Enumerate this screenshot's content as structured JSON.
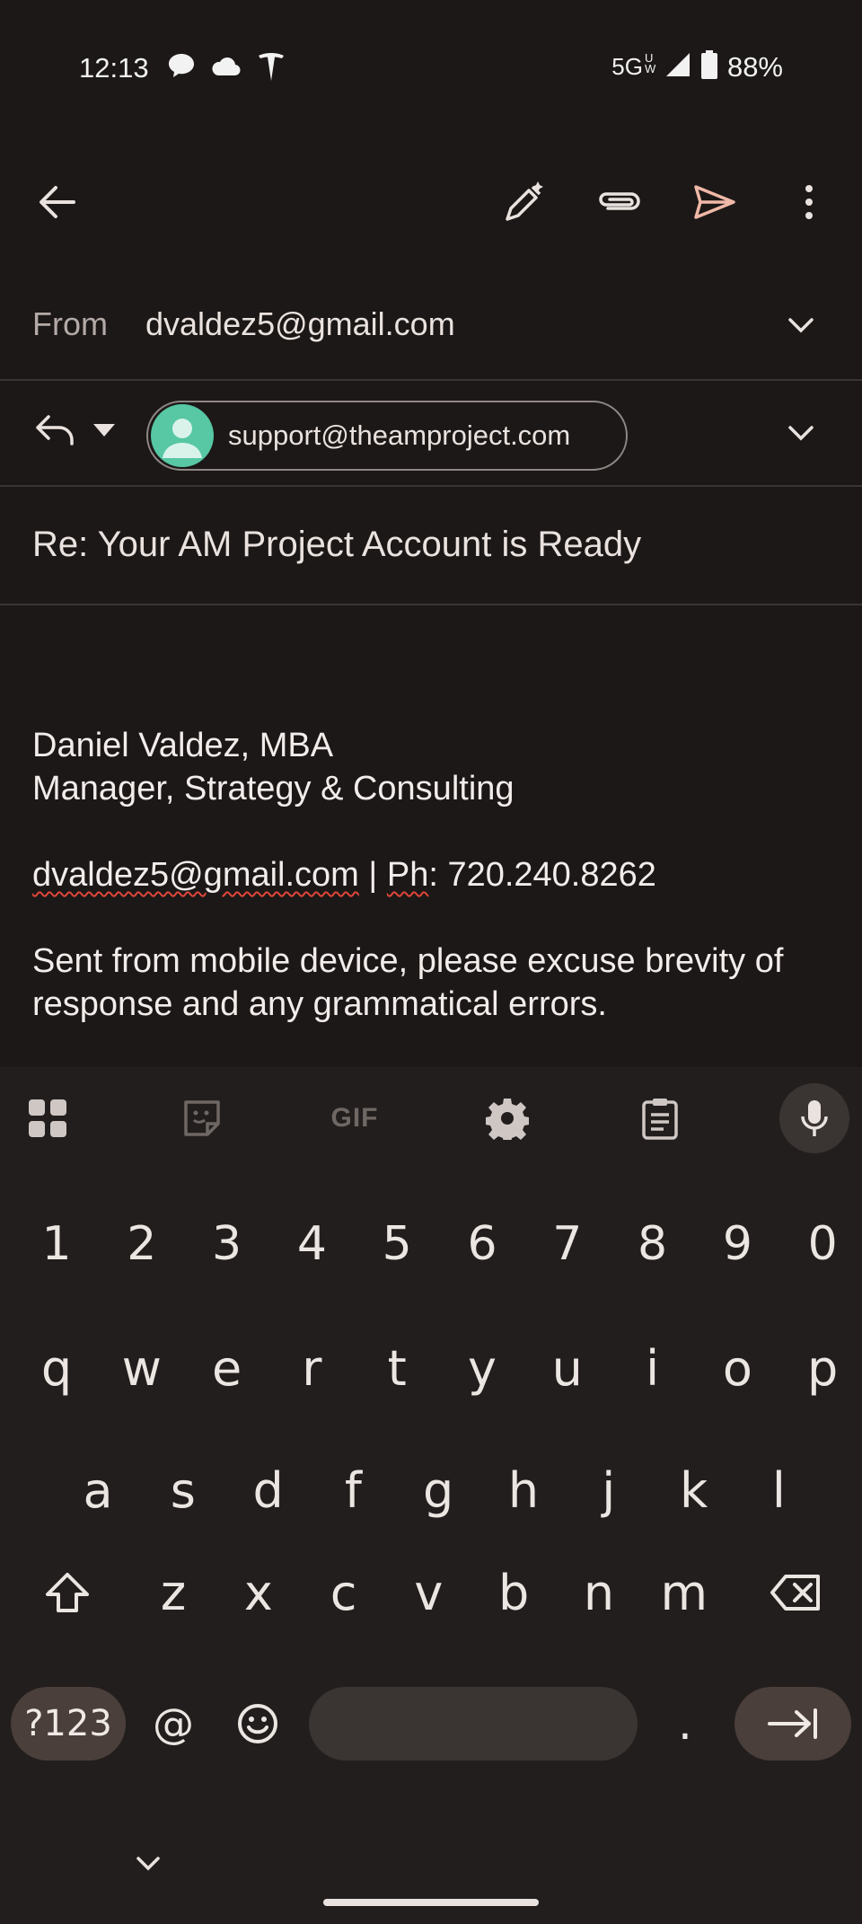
{
  "status_bar": {
    "time": "12:13",
    "network": "5G",
    "network_sup": "UW",
    "battery": "88%",
    "icons": [
      "chat-bubble-icon",
      "cloud-icon",
      "tesla-icon",
      "signal-icon",
      "battery-icon"
    ]
  },
  "toolbar": {
    "back": "back-arrow-icon",
    "compose_ai": "pencil-sparkle-icon",
    "attach": "paperclip-icon",
    "send": "send-icon",
    "more": "more-vert-icon"
  },
  "header": {
    "from_label": "From",
    "from_value": "dvaldez5@gmail.com",
    "to_chip": "support@theamproject.com",
    "subject": "Re: Your AM Project Account is Ready"
  },
  "body": {
    "name": "Daniel Valdez, MBA",
    "title": "Manager, Strategy & Consulting",
    "contact_email": "dvaldez5@gmail.com",
    "contact_sep": " | ",
    "contact_ph_label": "Ph",
    "contact_phone": ": 720.240.8262",
    "disclaimer_line1": "Sent from mobile device, please excuse brevity of",
    "disclaimer_line2": "response and any grammatical errors."
  },
  "keyboard": {
    "toolbar": {
      "gif": "GIF"
    },
    "numbers": [
      "1",
      "2",
      "3",
      "4",
      "5",
      "6",
      "7",
      "8",
      "9",
      "0"
    ],
    "row1": [
      "q",
      "w",
      "e",
      "r",
      "t",
      "y",
      "u",
      "i",
      "o",
      "p"
    ],
    "row2": [
      "a",
      "s",
      "d",
      "f",
      "g",
      "h",
      "j",
      "k",
      "l"
    ],
    "row3": [
      "z",
      "x",
      "c",
      "v",
      "b",
      "n",
      "m"
    ],
    "symbols_key": "?123",
    "at_key": "@",
    "period_key": "."
  },
  "colors": {
    "background": "#1c1817",
    "keyboard_bg": "#221e1d",
    "send_accent": "#f0b8a8",
    "avatar_green": "#57c7a4",
    "pill_key": "#4a3f3a"
  }
}
